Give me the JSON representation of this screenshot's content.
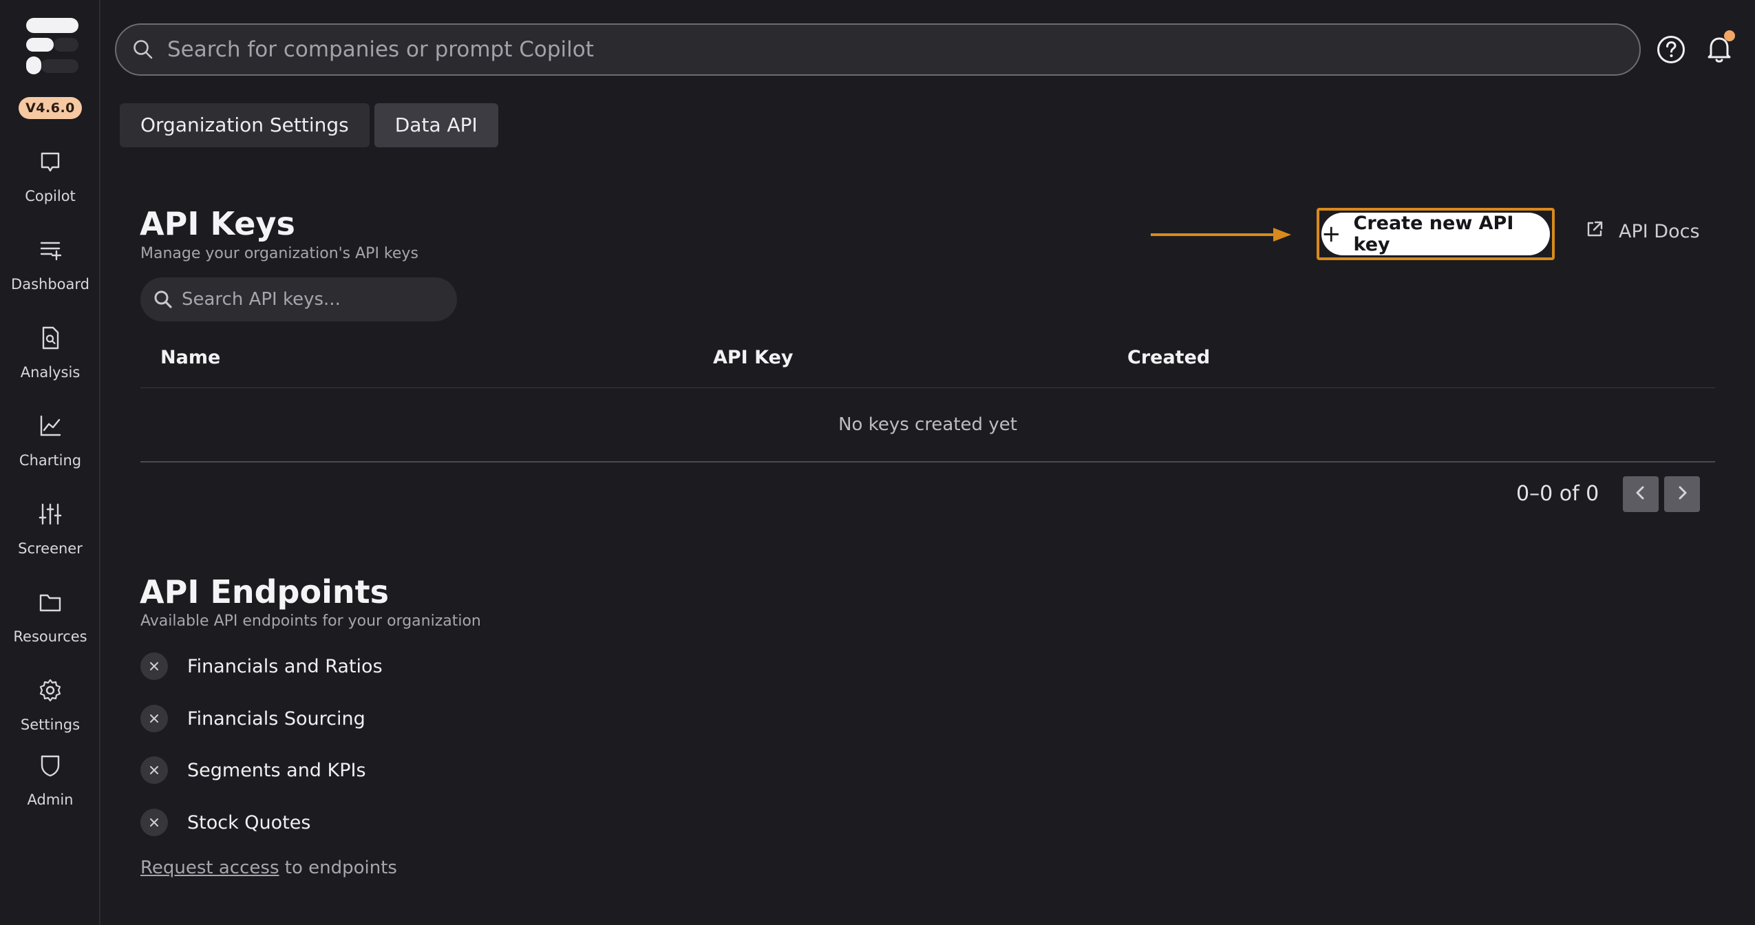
{
  "app": {
    "version": "V4.6.0"
  },
  "sidebar": {
    "items": [
      {
        "label": "Copilot",
        "icon": "chat-bubble-icon"
      },
      {
        "label": "Dashboard",
        "icon": "list-add-icon"
      },
      {
        "label": "Analysis",
        "icon": "document-search-icon"
      },
      {
        "label": "Charting",
        "icon": "line-chart-icon"
      },
      {
        "label": "Screener",
        "icon": "sliders-icon"
      },
      {
        "label": "Resources",
        "icon": "folder-icon"
      },
      {
        "label": "Settings",
        "icon": "gear-icon"
      },
      {
        "label": "Admin",
        "icon": "shield-icon"
      }
    ]
  },
  "search": {
    "placeholder": "Search for companies or prompt Copilot"
  },
  "tabs": [
    {
      "label": "Organization Settings",
      "active": false
    },
    {
      "label": "Data API",
      "active": true
    }
  ],
  "api_keys": {
    "title": "API Keys",
    "subtitle": "Manage your organization's API keys",
    "search_placeholder": "Search API keys...",
    "create_button": "Create new API key",
    "create_plus": "+",
    "docs_link": "API Docs",
    "columns": [
      "Name",
      "API Key",
      "Created"
    ],
    "empty_message": "No keys created yet",
    "pagination": "0–0 of 0"
  },
  "api_endpoints": {
    "title": "API Endpoints",
    "subtitle": "Available API endpoints for your organization",
    "items": [
      "Financials and Ratios",
      "Financials Sourcing",
      "Segments and KPIs",
      "Stock Quotes"
    ],
    "request_link": "Request access",
    "request_suffix": " to endpoints"
  },
  "colors": {
    "background": "#1c1c20",
    "accent_highlight": "#d98a1c",
    "version_badge": "#f6c9a3",
    "notification_dot": "#f1a766"
  }
}
